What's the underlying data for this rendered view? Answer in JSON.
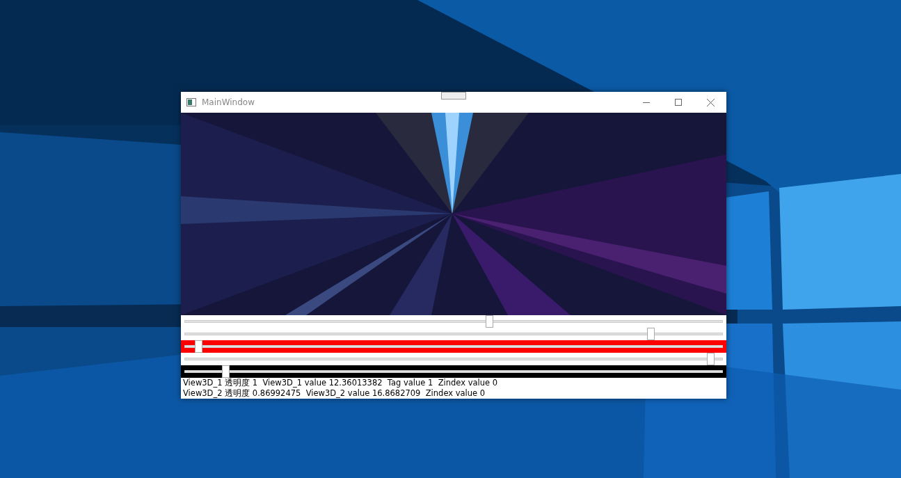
{
  "window": {
    "title": "MainWindow"
  },
  "sliders": [
    {
      "level": 0.566,
      "color": "#ffffff"
    },
    {
      "level": 0.866,
      "color": "#ffffff"
    },
    {
      "level": 0.026,
      "color": "#ff0000"
    },
    {
      "level": 0.977,
      "color": "#ffffff"
    },
    {
      "level": 0.076,
      "color": "#000000"
    }
  ],
  "status_lines": [
    "View3D_1 透明度 1  View3D_1 value 12.36013382  Tag value 1  Zindex value 0",
    "View3D_2 透明度 0.86992475  View3D_2 value 16.8682709  Zindex value 0"
  ]
}
